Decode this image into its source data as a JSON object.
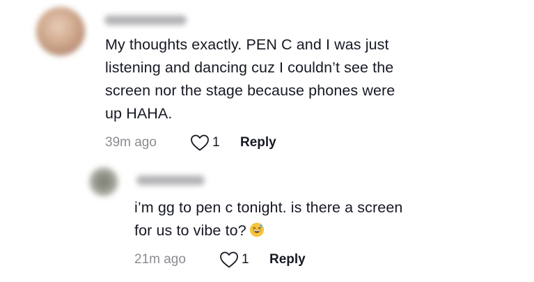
{
  "comments": [
    {
      "username": "",
      "text": "My thoughts exactly. PEN C and I was just\nlistening and dancing cuz I couldn’t see the\nscreen nor the stage because phones were\nup HAHA.",
      "time": "39m ago",
      "likes": "1",
      "reply_label": "Reply",
      "avatar_icon": "blurred-avatar"
    },
    {
      "username": "",
      "text": "i’m gg to pen c tonight. is there a screen\nfor us to vibe to?",
      "emoji": "grinning-face-with-sweat-icon",
      "time": "21m ago",
      "likes": "1",
      "reply_label": "Reply",
      "avatar_icon": "blurred-avatar"
    }
  ],
  "colors": {
    "text": "#161823",
    "muted": "#8a8b91",
    "heart_stroke": "#161823",
    "emoji_face": "#f6c33b"
  }
}
